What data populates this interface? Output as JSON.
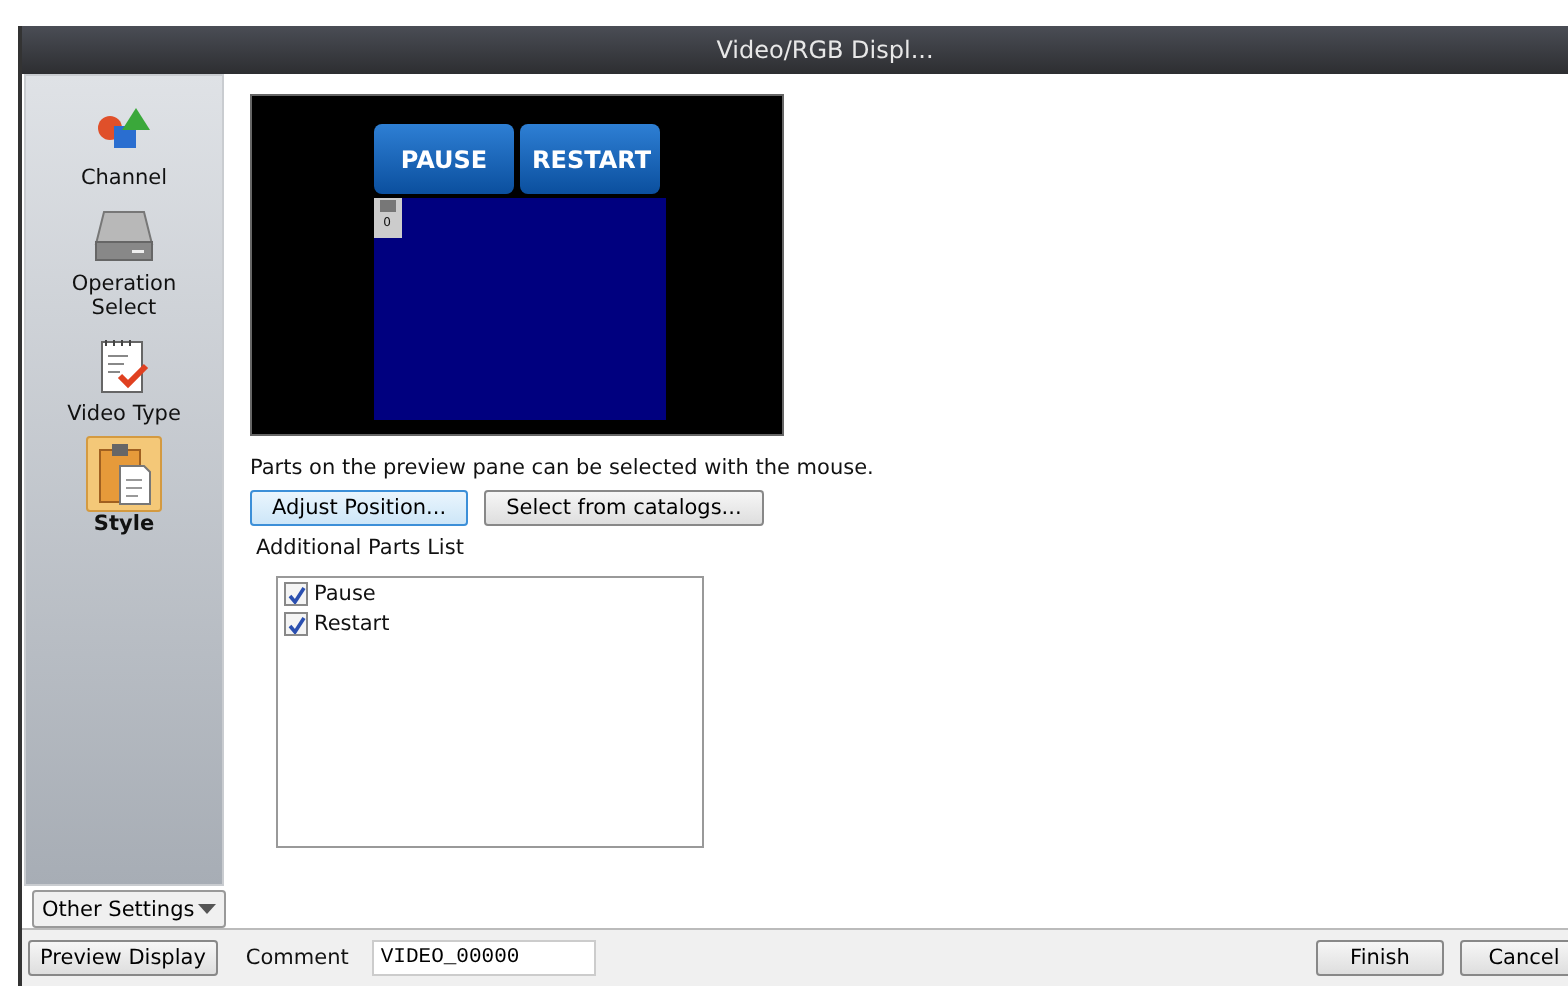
{
  "window": {
    "title": "Video/RGB Displ..."
  },
  "sidebar": {
    "items": [
      {
        "label": "Channel",
        "selected": false
      },
      {
        "label": "Operation\nSelect",
        "selected": false
      },
      {
        "label": "Video Type",
        "selected": false
      },
      {
        "label": "Style",
        "selected": true
      }
    ],
    "other_settings": "Other Settings"
  },
  "preview": {
    "buttons": [
      "PAUSE",
      "RESTART"
    ],
    "part_marker": "0"
  },
  "hint": "Parts on the preview pane can be selected with the mouse.",
  "actions": [
    "Adjust Position...",
    "Select from catalogs..."
  ],
  "parts_list": {
    "label": "Additional Parts List",
    "items": [
      {
        "label": "Pause",
        "checked": true
      },
      {
        "label": "Restart",
        "checked": true
      }
    ]
  },
  "footer": {
    "preview_button": "Preview Display",
    "comment_label": "Comment",
    "comment_value": "VIDEO_00000",
    "buttons": [
      "Finish",
      "Cancel"
    ]
  }
}
